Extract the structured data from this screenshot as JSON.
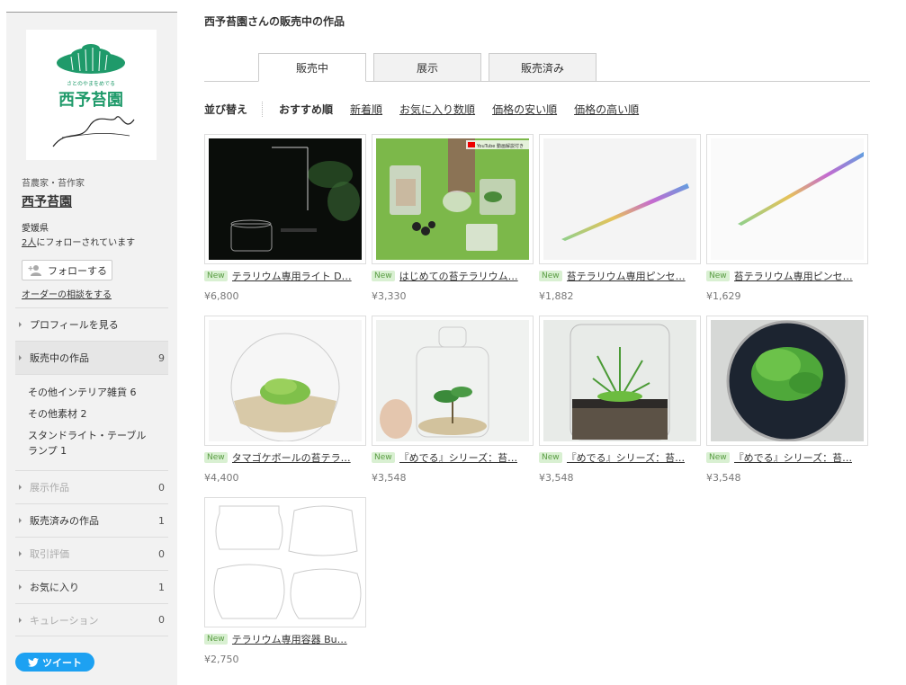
{
  "sidebar": {
    "logo_text": "西予苔園",
    "logo_subtext": "さとのやまをめでる",
    "creator_type": "苔農家・苔作家",
    "creator_name": "西予苔園",
    "prefecture": "愛媛県",
    "followers_count": "2人",
    "followers_suffix": "にフォローされています",
    "follow_label": "フォローする",
    "order_label": "オーダーの相談をする",
    "menu": [
      {
        "label": "プロフィールを見る",
        "count": ""
      },
      {
        "label": "販売中の作品",
        "count": "9"
      },
      {
        "label": "展示作品",
        "count": "0"
      },
      {
        "label": "販売済みの作品",
        "count": "1"
      },
      {
        "label": "取引評価",
        "count": "0"
      },
      {
        "label": "お気に入り",
        "count": "1"
      },
      {
        "label": "キュレーション",
        "count": "0"
      }
    ],
    "submenu": [
      {
        "label": "その他インテリア雑貨",
        "count": "6"
      },
      {
        "label": "その他素材",
        "count": "2"
      },
      {
        "label": "スタンドライト・テーブルランプ",
        "count": "1"
      }
    ],
    "tweet_label": "ツイート"
  },
  "main": {
    "title": "西予苔園さんの販売中の作品",
    "tabs": [
      "販売中",
      "展示",
      "販売済み"
    ],
    "sort_label": "並び替え",
    "sort_options": [
      "おすすめ順",
      "新着順",
      "お気に入り数順",
      "価格の安い順",
      "価格の高い順"
    ],
    "new_badge": "New",
    "products": [
      {
        "title": "テラリウム専用ライト D…",
        "price": "¥6,800"
      },
      {
        "title": "はじめての苔テラリウム…",
        "price": "¥3,330"
      },
      {
        "title": "苔テラリウム専用ピンセ…",
        "price": "¥1,882"
      },
      {
        "title": "苔テラリウム専用ピンセ…",
        "price": "¥1,629"
      },
      {
        "title": "タマゴケボールの苔テラ…",
        "price": "¥4,400"
      },
      {
        "title": "『めでる』シリーズ：苔…",
        "price": "¥3,548"
      },
      {
        "title": "『めでる』シリーズ：苔…",
        "price": "¥3,548"
      },
      {
        "title": "『めでる』シリーズ：苔…",
        "price": "¥3,548"
      },
      {
        "title": "テラリウム専用容器 Bu…",
        "price": "¥2,750"
      }
    ],
    "youtube_badge": "YouTube 動画解説付き"
  },
  "colors": {
    "brand_green": "#1f9a6a",
    "new_badge_bg": "#d9f0d2",
    "twitter_blue": "#1da1f2"
  }
}
